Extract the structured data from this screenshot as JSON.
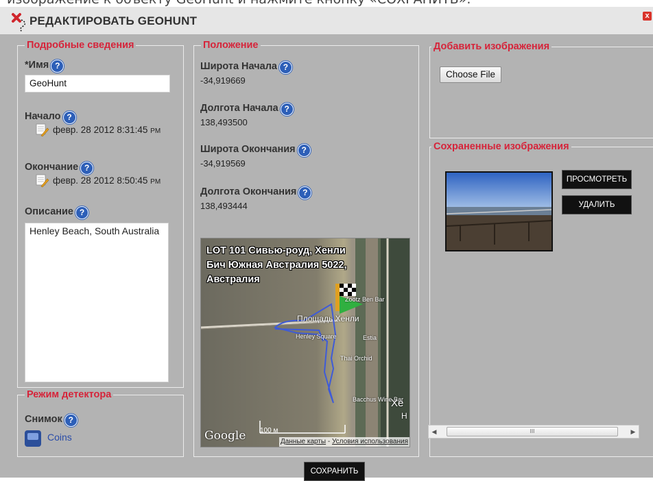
{
  "header": {
    "cut_text": "изображение к объекту GeoHunt и нажмите кнопку «СОХРАНИТЬ».",
    "title": "РЕДАКТИРОВАТЬ GEOHUNT",
    "close": "x"
  },
  "details": {
    "legend": "Подробные сведения",
    "name_label": "*Имя",
    "name_value": "GeoHunt",
    "start_label": "Начало",
    "start_value": "февр. 28 2012 8:31:45",
    "start_ampm": "PM",
    "end_label": "Окончание",
    "end_value": "февр. 28 2012 8:50:45",
    "end_ampm": "PM",
    "description_label": "Описание",
    "description_value": "Henley Beach, South Australia"
  },
  "detector": {
    "legend": "Режим детектора",
    "snapshot_label": "Снимок",
    "snapshot_value": "Coins"
  },
  "position": {
    "legend": "Положение",
    "start_lat_label": "Широта Начала",
    "start_lat_value": "-34,919669",
    "start_lng_label": "Долгота Начала",
    "start_lng_value": "138,493500",
    "end_lat_label": "Широта Окончания",
    "end_lat_value": "-34,919569",
    "end_lng_label": "Долгота Окончания",
    "end_lng_value": "138,493444"
  },
  "map": {
    "address": "LOT 101 Сивью-роуд, Хенли Бич Южная Австралия 5022, Австралия",
    "poi_square": "Площадь Хенли",
    "poi_square_en": "Henley Square",
    "poi_zootz": "Zootz Ben Bar",
    "poi_estia": "Estia",
    "poi_thai": "Thai Orchid",
    "poi_bacchus": "Bacchus Wine Bar",
    "poi_xe": "Xe",
    "poi_h": "H",
    "scale": "100 м",
    "google": "Google",
    "terms_data": "Данные карты",
    "terms_sep": " - ",
    "terms_conditions": "Условия использования"
  },
  "add_images": {
    "legend": "Добавить изображения",
    "choose_file": "Choose File"
  },
  "saved_images": {
    "legend": "Сохраненные изображения",
    "view_button": "ПРОСМОТРЕТЬ",
    "delete_button": "УДАЛИТЬ",
    "scroll_grip": "III"
  },
  "footer": {
    "save_button": "СОХРАНИТЬ"
  },
  "help_glyph": "?",
  "colors": {
    "legend": "#d6243a",
    "dialog_bg": "#b3b3b3",
    "help_icon": "#2d5fb8",
    "link": "#2a4ca8"
  }
}
